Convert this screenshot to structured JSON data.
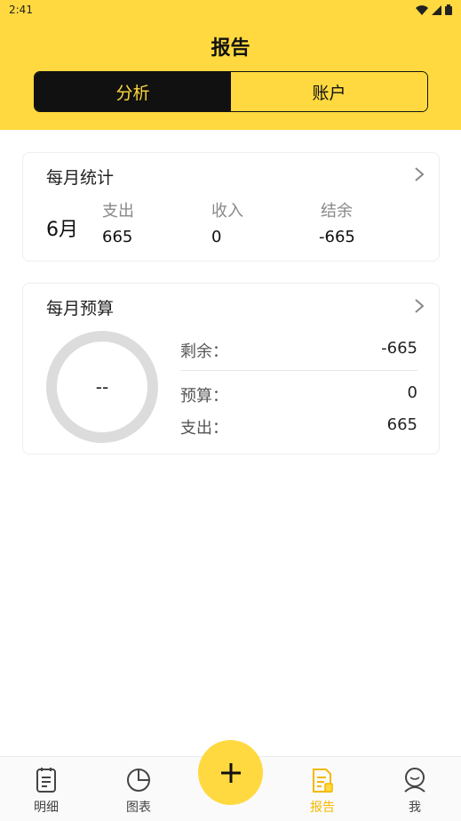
{
  "status_bar": {
    "time": "2:41"
  },
  "header": {
    "title": "报告"
  },
  "segment": {
    "tabs": [
      "分析",
      "账户"
    ],
    "active_index": 0
  },
  "monthly_stats": {
    "title": "每月统计",
    "month": "6月",
    "columns": [
      {
        "label": "支出",
        "value": "665"
      },
      {
        "label": "收入",
        "value": "0"
      },
      {
        "label": "结余",
        "value": "-665"
      }
    ]
  },
  "monthly_budget": {
    "title": "每月预算",
    "ring_text": "--",
    "rows": [
      {
        "label": "剩余：",
        "value": "-665"
      },
      {
        "label": "预算：",
        "value": "0"
      },
      {
        "label": "支出：",
        "value": "665"
      }
    ]
  },
  "tab_bar": {
    "items": [
      {
        "label": "明细",
        "icon": "notebook-icon"
      },
      {
        "label": "图表",
        "icon": "pie-chart-icon"
      },
      {
        "label": "",
        "icon": "plus-icon"
      },
      {
        "label": "报告",
        "icon": "report-icon"
      },
      {
        "label": "我",
        "icon": "profile-icon"
      }
    ],
    "active_index": 3
  },
  "colors": {
    "accent": "#FFD93F",
    "active_tab": "#F5B800",
    "dark": "#111111"
  }
}
